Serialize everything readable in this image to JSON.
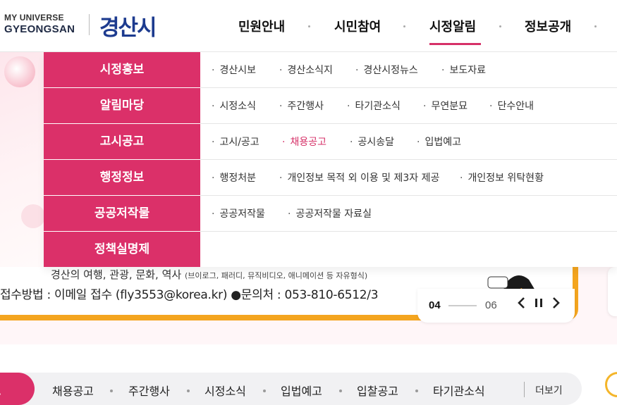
{
  "logo": {
    "en_line1": "MY UNIVERSE",
    "en_line2": "GYEONGSAN",
    "kr": "경산시"
  },
  "gnb": {
    "items": [
      {
        "label": "민원안내"
      },
      {
        "label": "시민참여"
      },
      {
        "label": "시정알림"
      },
      {
        "label": "정보공개"
      }
    ],
    "active": "시정알림"
  },
  "mega_menu": {
    "rows": [
      {
        "category": "시정홍보",
        "items": [
          "경산시보",
          "경산소식지",
          "경산시정뉴스",
          "보도자료"
        ]
      },
      {
        "category": "알림마당",
        "items": [
          "시정소식",
          "주간행사",
          "타기관소식",
          "무연분묘",
          "단수안내"
        ]
      },
      {
        "category": "고시공고",
        "items": [
          "고시/공고",
          "채용공고",
          "공시송달",
          "입법예고"
        ]
      },
      {
        "category": "행정정보",
        "items": [
          "행정처분",
          "개인정보 목적 외 이용 및 제3자 제공",
          "개인정보 위탁현황"
        ]
      },
      {
        "category": "공공저작물",
        "items": [
          "공공저작물",
          "공공저작물 자료실"
        ]
      },
      {
        "category": "정책실명제",
        "items": []
      }
    ],
    "highlighted_item": "채용공고",
    "bullet": "·"
  },
  "banner": {
    "line1": "경산의 여행, 관광, 문화, 역사",
    "line1_small": "(브이로그, 패러디, 뮤직비디오, 애니메이션 등 자유형식)",
    "line2": "접수방법 : 이메일 접수 (fly3553@korea.kr) ●문의처 : 053-810-6512/3",
    "current": "04",
    "total": "06",
    "prev_icon": "chevron-left-icon",
    "pause_icon": "pause-icon",
    "next_icon": "chevron-right-icon"
  },
  "bottom_tabs": {
    "active": "공고",
    "items": [
      "채용공고",
      "주간행사",
      "시정소식",
      "입법예고",
      "입찰공고",
      "타기관소식"
    ],
    "more": "더보기"
  },
  "colors": {
    "accent": "#db3069",
    "brand_blue": "#1d3b8f",
    "banner_orange": "#f4a51f"
  }
}
